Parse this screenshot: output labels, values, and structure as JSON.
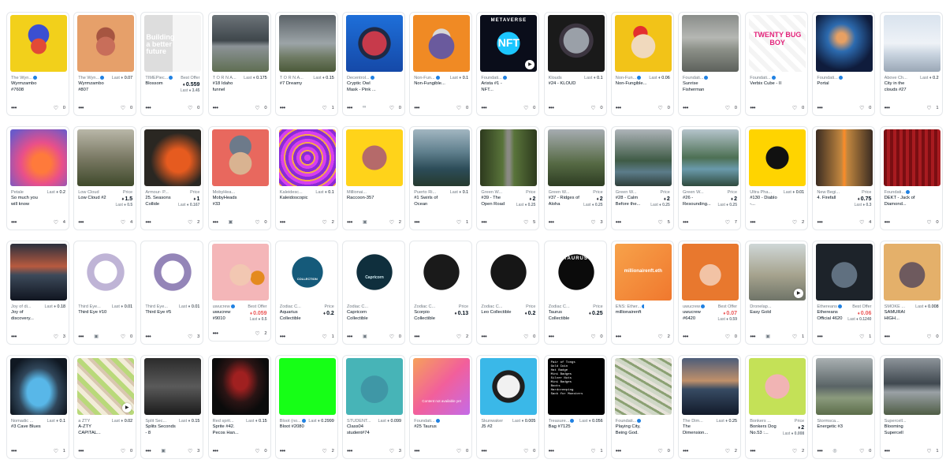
{
  "rows": [
    [
      {
        "collection": "The Wyn...",
        "verified": true,
        "name": "Wyrmzambo #7608",
        "price_label": "",
        "price": "",
        "last_sale": "",
        "favs": "0",
        "thumb": "wyrm-yellow"
      },
      {
        "collection": "The Wyn...",
        "verified": true,
        "name": "Wyrmzambo #807",
        "price_label": "",
        "price": "",
        "last_sale": "0.07",
        "favs": "0",
        "thumb": "wyrm-orange"
      },
      {
        "collection": "TIMEPiec...",
        "verified": true,
        "name": "Blossom",
        "price_label": "Best Offer",
        "price": "0.559",
        "price_red": false,
        "last_sale": "3.45",
        "last_below": true,
        "favs": "0",
        "thumb": "building"
      },
      {
        "collection": "T O R N A...",
        "verified": false,
        "name": "#18 Idaho funnel",
        "price_label": "",
        "price": "",
        "last_sale": "0.175",
        "favs": "0",
        "thumb": "storm1"
      },
      {
        "collection": "T O R N A...",
        "verified": false,
        "name": "#7 Dreamy",
        "price_label": "",
        "price": "",
        "last_sale": "0.15",
        "favs": "1",
        "thumb": "storm2"
      },
      {
        "collection": "Decentrol...",
        "verified": true,
        "name": "Cryptic Owl Mask - Pink ...",
        "price_label": "",
        "price": "",
        "last_sale": "",
        "favs": "0",
        "icon": "link-icon",
        "thumb": "owl"
      },
      {
        "collection": "Non-Fun...",
        "verified": true,
        "name": "Non-Fungible...",
        "price_label": "",
        "price": "",
        "last_sale": "0.1",
        "favs": "0",
        "thumb": "bull"
      },
      {
        "collection": "Foundati...",
        "verified": true,
        "name": "Arista #1 - NFT...",
        "price_label": "",
        "price": "",
        "last_sale": "",
        "favs": "0",
        "play": true,
        "thumb": "metaverse"
      },
      {
        "collection": "Klouds",
        "verified": false,
        "name": "#24 - KLOUD",
        "price_label": "",
        "price": "",
        "last_sale": "0.1",
        "favs": "0",
        "thumb": "kloud"
      },
      {
        "collection": "Non-Fun...",
        "verified": true,
        "name": "Non-Fungible...",
        "price_label": "",
        "price": "",
        "last_sale": "0.06",
        "favs": "0",
        "thumb": "ape"
      },
      {
        "collection": "Foundati...",
        "verified": true,
        "name": "Sunrise Fisherman",
        "price_label": "",
        "price": "",
        "last_sale": "",
        "favs": "0",
        "thumb": "fisher"
      },
      {
        "collection": "Foundati...",
        "verified": true,
        "name": "Verbix Cube - II",
        "price_label": "",
        "price": "",
        "last_sale": "",
        "favs": "0",
        "thumb": "verbix"
      },
      {
        "collection": "Foundati...",
        "verified": true,
        "name": "Portal",
        "price_label": "",
        "price": "",
        "last_sale": "",
        "favs": "0",
        "thumb": "portal"
      },
      {
        "collection": "Above Ch...",
        "verified": false,
        "name": "City in the clouds #27",
        "price_label": "",
        "price": "",
        "last_sale": "0.2",
        "favs": "1",
        "thumb": "clouds-city"
      }
    ],
    [
      {
        "collection": "Petale",
        "verified": false,
        "name": "So much you will know",
        "price_label": "",
        "price": "",
        "last_sale": "0.2",
        "favs": "4",
        "thumb": "petale"
      },
      {
        "collection": "Low Cloud",
        "verified": false,
        "name": "Low Cloud #2",
        "price_label": "Price",
        "price": "1.5",
        "last_sale": "0.5",
        "favs": "4",
        "thumb": "lowcloud"
      },
      {
        "collection": "Armour- P...",
        "verified": false,
        "name": "25. Seasons Collide",
        "price_label": "Price",
        "price": "1",
        "last_sale": "0.167",
        "favs": "2",
        "thumb": "seasons"
      },
      {
        "collection": "MobyHea...",
        "verified": false,
        "name": "MobyHeads #33",
        "price_label": "",
        "price": "",
        "last_sale": "",
        "favs": "0",
        "icon": "lock-icon",
        "thumb": "moby"
      },
      {
        "collection": "Kaleidesc...",
        "verified": false,
        "name": "Kaleidoscopic",
        "price_label": "",
        "price": "",
        "last_sale": "0.1",
        "favs": "2",
        "thumb": "kaleido"
      },
      {
        "collection": "Millionai...",
        "verified": false,
        "name": "Raccoon-357",
        "price_label": "",
        "price": "",
        "last_sale": "",
        "favs": "2",
        "icon": "lock-icon",
        "thumb": "raccoon"
      },
      {
        "collection": "Puerto Ri...",
        "verified": false,
        "name": "#1 Swirls of Ocean",
        "price_label": "",
        "price": "",
        "last_sale": "0.1",
        "favs": "1",
        "thumb": "ocean"
      },
      {
        "collection": "Green W...",
        "verified": false,
        "name": "#39 - The Open Road",
        "price_label": "Price",
        "price": "2",
        "last_sale": "0.25",
        "favs": "5",
        "thumb": "road"
      },
      {
        "collection": "Green W...",
        "verified": false,
        "name": "#37 - Ridges of Aloha",
        "price_label": "Price",
        "price": "2",
        "last_sale": "0.25",
        "favs": "3",
        "thumb": "ridges"
      },
      {
        "collection": "Green W...",
        "verified": false,
        "name": "#28 - Calm Before the...",
        "price_label": "Price",
        "price": "2",
        "last_sale": "0.25",
        "favs": "5",
        "thumb": "calm"
      },
      {
        "collection": "Green W...",
        "verified": false,
        "name": "#26 - Resounding...",
        "price_label": "Price",
        "price": "2",
        "last_sale": "0.25",
        "favs": "7",
        "thumb": "lake"
      },
      {
        "collection": "Ultra Pha...",
        "verified": false,
        "name": "#130 - Diablo -...",
        "price_label": "",
        "price": "",
        "last_sale": "0.01",
        "favs": "2",
        "thumb": "diablo"
      },
      {
        "collection": "New Begi...",
        "verified": false,
        "name": "4. Firefall",
        "price_label": "Price",
        "price": "0.75",
        "last_sale": "0.3",
        "favs": "4",
        "thumb": "firefall"
      },
      {
        "collection": "Foundati...",
        "verified": true,
        "name": "DEKT - Jack of Diamond...",
        "price_label": "",
        "price": "",
        "last_sale": "",
        "favs": "0",
        "thumb": "dekt"
      }
    ],
    [
      {
        "collection": "Joy of di...",
        "verified": false,
        "name": "Joy of discovery...",
        "price_label": "",
        "price": "",
        "last_sale": "0.18",
        "favs": "3",
        "thumb": "joy"
      },
      {
        "collection": "Third Eye...",
        "verified": false,
        "name": "Third Eye #10",
        "price_label": "",
        "price": "",
        "last_sale": "0.01",
        "favs": "0",
        "icon": "lock-icon",
        "thumb": "eye1"
      },
      {
        "collection": "Third Eye...",
        "verified": false,
        "name": "Third Eye #5",
        "price_label": "",
        "price": "",
        "last_sale": "0.01",
        "favs": "3",
        "thumb": "eye2"
      },
      {
        "collection": "uwucrew",
        "verified": true,
        "name": "uwucrew #9010",
        "price_label": "Best Offer",
        "price": "0.059",
        "price_red": true,
        "last_sale": "0.5",
        "last_below": true,
        "favs": "2",
        "thumb": "uwu1"
      },
      {
        "collection": "Zodiac C...",
        "verified": false,
        "name": "Aquarius Collectible",
        "price_label": "Price",
        "price": "0.2",
        "last_sale": "",
        "favs": "1",
        "thumb": "aquarius"
      },
      {
        "collection": "Zodiac C...",
        "verified": false,
        "name": "Capricorn Collectible",
        "price_label": "",
        "price": "",
        "last_sale": "",
        "favs": "0",
        "icon": "lock-icon",
        "thumb": "capricorn"
      },
      {
        "collection": "Zodiac C...",
        "verified": false,
        "name": "Scorpio Collectible",
        "price_label": "Price",
        "price": "0.13",
        "last_sale": "",
        "favs": "2",
        "thumb": "scorpio"
      },
      {
        "collection": "Zodiac C...",
        "verified": false,
        "name": "Leo Collectible",
        "price_label": "Price",
        "price": "0.2",
        "last_sale": "",
        "favs": "0",
        "thumb": "leo"
      },
      {
        "collection": "Zodiac C...",
        "verified": false,
        "name": "Taurus Collectible",
        "price_label": "Price",
        "price": "0.25",
        "last_sale": "",
        "favs": "0",
        "thumb": "taurus"
      },
      {
        "collection": "ENS: Ether...",
        "verified": true,
        "name": "millionairenft",
        "price_label": "",
        "price": "",
        "last_sale": "",
        "favs": "2",
        "thumb": "ens"
      },
      {
        "collection": "uwucrew",
        "verified": true,
        "name": "uwucrew #6420",
        "price_label": "Best Offer",
        "price": "0.07",
        "price_red": true,
        "last_sale": "0.59",
        "last_below": true,
        "favs": "0",
        "thumb": "uwu2"
      },
      {
        "collection": "Dronelap...",
        "verified": false,
        "name": "Easy Gold",
        "price_label": "",
        "price": "",
        "last_sale": "",
        "favs": "1",
        "icon": "lock-icon",
        "play": true,
        "thumb": "drone"
      },
      {
        "collection": "Ethereans",
        "verified": true,
        "name": "Ethereans Official 4620",
        "price_label": "Best Offer",
        "price": "0.06",
        "price_red": true,
        "last_sale": "0.1240",
        "last_below": true,
        "favs": "1",
        "thumb": "etherean"
      },
      {
        "collection": "SMOKE ...",
        "verified": false,
        "name": "SAMURAI HIGH...",
        "price_label": "",
        "price": "",
        "last_sale": "0.008",
        "favs": "0",
        "thumb": "samurai"
      }
    ],
    [
      {
        "collection": "Nomadic ...",
        "verified": false,
        "name": "#3 Cave Blues",
        "price_label": "",
        "price": "",
        "last_sale": "0.1",
        "favs": "1",
        "thumb": "cave"
      },
      {
        "collection": "a ZTY",
        "verified": false,
        "name": "A-ZTY CAPITAL...",
        "price_label": "",
        "price": "",
        "last_sale": "0.02",
        "favs": "0",
        "play": true,
        "thumb": "city"
      },
      {
        "collection": "Split Sec...",
        "verified": false,
        "name": "Splits Seconds - 8",
        "price_label": "",
        "price": "",
        "last_sale": "0.15",
        "favs": "3",
        "icon": "lock-icon",
        "thumb": "split"
      },
      {
        "collection": "Red sprit...",
        "verified": false,
        "name": "Sprite #42. Pecos Han...",
        "price_label": "",
        "price": "",
        "last_sale": "0.15",
        "favs": "0",
        "thumb": "sprite"
      },
      {
        "collection": "Bloot (no...",
        "verified": true,
        "name": "Bloot #2080",
        "price_label": "",
        "price": "",
        "last_sale": "0.2999",
        "favs": "2",
        "thumb": "bloot"
      },
      {
        "collection": "STUDENT...",
        "verified": false,
        "name": "Class04 student#74",
        "price_label": "",
        "price": "",
        "last_sale": "0.099",
        "favs": "3",
        "thumb": "student"
      },
      {
        "collection": "Foundati...",
        "verified": true,
        "name": "#25 Taurus",
        "price_label": "",
        "price": "",
        "last_sale": "",
        "favs": "0",
        "thumb": "unavailable",
        "unavailable_text": "Content not available yet"
      },
      {
        "collection": "Skunwaker",
        "verified": false,
        "name": "J5 #2",
        "price_label": "",
        "price": "",
        "last_sale": "0.005",
        "favs": "0",
        "thumb": "skun"
      },
      {
        "collection": "Treasure...",
        "verified": true,
        "name": "Bag #7125",
        "price_label": "",
        "price": "",
        "last_sale": "0.056",
        "favs": "1",
        "thumb": "bag"
      },
      {
        "collection": "Foundati...",
        "verified": true,
        "name": "Playing City, Being God.",
        "price_label": "",
        "price": "",
        "last_sale": "",
        "favs": "0",
        "thumb": "playingcity"
      },
      {
        "collection": "The Dim...",
        "verified": false,
        "name": "The Dimension...",
        "price_label": "",
        "price": "",
        "last_sale": "0.25",
        "favs": "2",
        "thumb": "dimension"
      },
      {
        "collection": "Bonkers ...",
        "verified": false,
        "name": "Bonkers Dog No.53 :...",
        "price_label": "Price",
        "price": "2",
        "last_sale": "0.008",
        "favs": "2",
        "thumb": "bonkers"
      },
      {
        "collection": "Stormsca...",
        "verified": false,
        "name": "Energetic #3",
        "price_label": "",
        "price": "",
        "last_sale": "",
        "favs": "0",
        "icon": "globe-icon",
        "thumb": "stormscape"
      },
      {
        "collection": "Supercell...",
        "verified": false,
        "name": "Blooming Supercell",
        "price_label": "",
        "price": "",
        "last_sale": "",
        "favs": "1",
        "thumb": "supercell"
      }
    ]
  ],
  "labels": {
    "last": "Last",
    "best_offer": "Best Offer",
    "price": "Price"
  },
  "thumb_text": {
    "building": "Building a better future",
    "metaverse": "METAVERSE",
    "nft": "NFT",
    "verbix": "TWENTY BUG BOY",
    "ens": "millionairenft.eth",
    "taurus": "TAURUS",
    "aquarius": "COLLECTION",
    "capricorn": "Capricorn",
    "bag": "Pair of Tongs\nGold Coin\nHat Badge\nMini Badges\nSilver Nuts\nMini Badges\nBoots\nHardcreeping\nSack for Monsters"
  }
}
